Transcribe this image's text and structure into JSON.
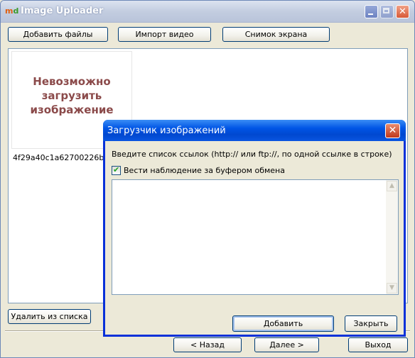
{
  "window": {
    "title": "Image Uploader",
    "icon_text": "m",
    "icon_text_2": "d",
    "close_glyph": "✕"
  },
  "toolbar": {
    "add_files": "Добавить файлы",
    "import_video": "Импорт видео",
    "screenshot": "Снимок экрана"
  },
  "list": {
    "items": [
      {
        "error_text": "Невозможно загрузить изображение",
        "filename": "4f29a40c1a62700226bf45"
      }
    ]
  },
  "bottom": {
    "remove_from_list": "Удалить из списка",
    "back": "< Назад",
    "next": "Далее >",
    "exit": "Выход"
  },
  "dialog": {
    "title": "Загрузчик изображений",
    "close_glyph": "✕",
    "prompt": "Введите список ссылок (http:// или ftp://, по одной ссылке в строке)",
    "watch_clipboard_label": "Вести наблюдение за буфером обмена",
    "watch_clipboard_checked": true,
    "check_glyph": "✔",
    "urls_value": "",
    "scroll_up": "▲",
    "scroll_down": "▼",
    "add": "Добавить",
    "close": "Закрыть"
  },
  "colors": {
    "titlebar_inactive": "#C3CDE0",
    "dialog_titlebar": "#0055E5",
    "error_text": "#8B4A4A"
  }
}
